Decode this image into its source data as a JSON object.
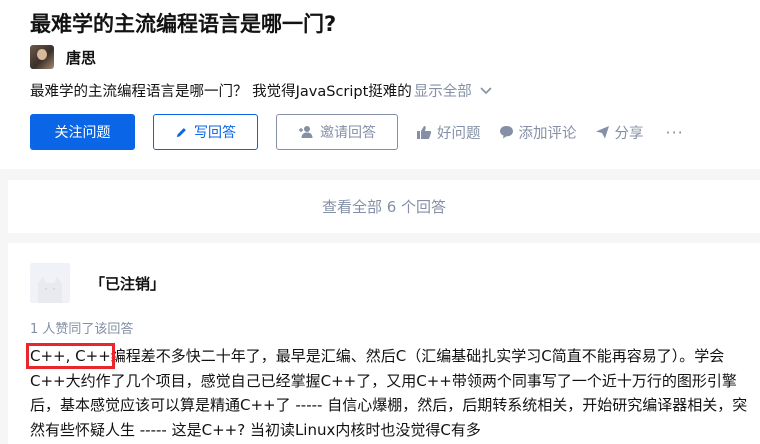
{
  "question": {
    "title": "最难学的主流编程语言是哪一门?",
    "author_name": "唐思",
    "description": "最难学的主流编程语言是哪一门？ 我觉得JavaScript挺难的",
    "show_all_label": "显示全部"
  },
  "actions": {
    "follow_label": "关注问题",
    "answer_label": "写回答",
    "invite_label": "邀请回答",
    "good_question_label": "好问题",
    "comment_label": "添加评论",
    "share_label": "分享",
    "more_label": "···"
  },
  "view_all_answers": "查看全部 6 个回答",
  "answer": {
    "author_name": "「已注销」",
    "likes_text": "1 人赞同了该回答",
    "highlight_text": "C++, C++",
    "body_rest": "编程差不多快二十年了，最早是汇编、然后C（汇编基础扎实学习C简直不能再容易了）。学会C++大约作了几个项目，感觉自己已经掌握C++了，又用C++带领两个同事写了一个近十万行的图形引擎后，基本感觉应该可以算是精通C++了 ----- 自信心爆棚，然后，后期转系统相关，开始研究编译器相关，突然有些怀疑人生 ----- 这是C++? 当初读Linux内核时也没觉得C有多"
  },
  "colors": {
    "primary": "#0a66e6",
    "muted": "#8590a6",
    "highlight_box": "#e8262c",
    "background": "#f6f6f6"
  },
  "icons": [
    "pencil-icon",
    "add-person-icon",
    "thumbs-up-icon",
    "comment-icon",
    "share-icon",
    "chevron-down-icon",
    "default-avatar-icon"
  ]
}
